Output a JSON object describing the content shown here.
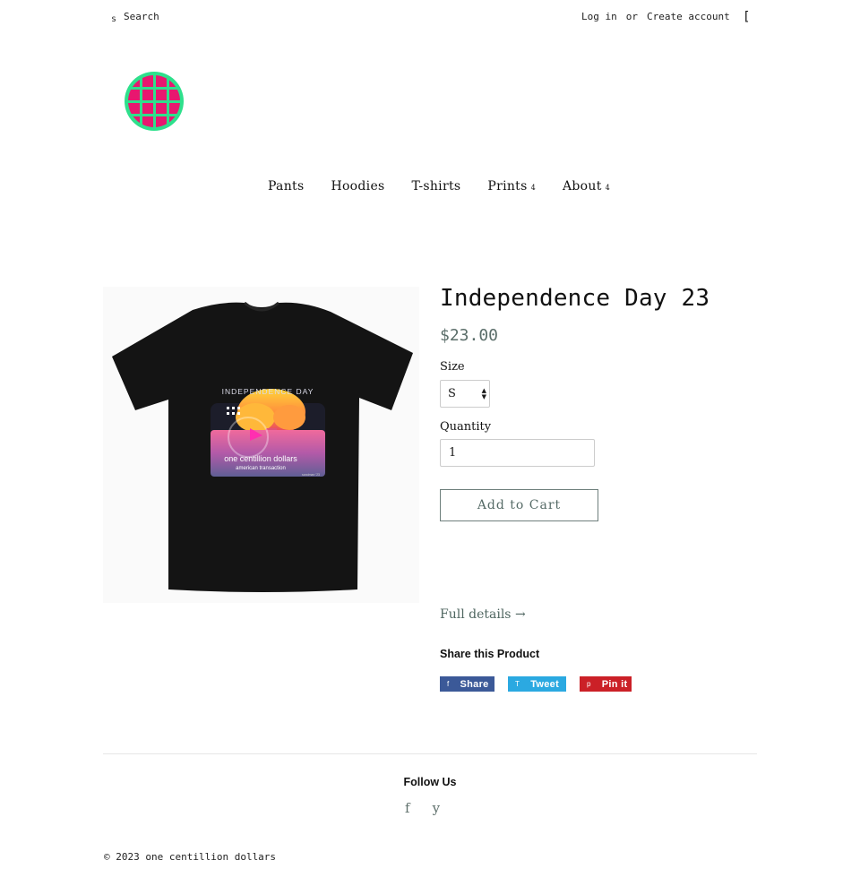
{
  "header": {
    "search_icon_glyph": "s",
    "search_placeholder": "Search",
    "login_label": "Log in",
    "or_label": "or",
    "create_account_label": "Create account",
    "cart_glyph": "["
  },
  "logo": {
    "name": "globe-logo",
    "colors": {
      "globe": "#2ee08c",
      "grid": "#e8176f"
    }
  },
  "nav": {
    "items": [
      {
        "label": "Pants",
        "has_dropdown": false
      },
      {
        "label": "Hoodies",
        "has_dropdown": false
      },
      {
        "label": "T-shirts",
        "has_dropdown": false
      },
      {
        "label": "Prints",
        "has_dropdown": true
      },
      {
        "label": "About",
        "has_dropdown": true
      }
    ],
    "dropdown_glyph": "4"
  },
  "product": {
    "title": "Independence Day 23",
    "price": "$23.00",
    "size_label": "Size",
    "size_selected": "S",
    "quantity_label": "Quantity",
    "quantity_value": "1",
    "add_to_cart_label": "Add to Cart",
    "full_details_label": "Full details →",
    "image": {
      "shirt_color": "#141414",
      "print_heading": "INDEPENDENCE DAY",
      "print_line1": "one centillion dollars",
      "print_line2": "american transaction",
      "print_signature": "sandman '23"
    }
  },
  "share": {
    "title": "Share this Product",
    "buttons": [
      {
        "icon": "f",
        "label": "Share",
        "color": "#3b5998"
      },
      {
        "icon": "T",
        "label": "Tweet",
        "color": "#2ba9e1"
      },
      {
        "icon": "p",
        "label": "Pin it",
        "color": "#cb2027"
      }
    ]
  },
  "footer": {
    "follow_title": "Follow Us",
    "social": [
      {
        "glyph": "f",
        "name": "facebook"
      },
      {
        "glyph": "y",
        "name": "youtube"
      }
    ],
    "copyright": "© 2023 one centillion dollars"
  }
}
